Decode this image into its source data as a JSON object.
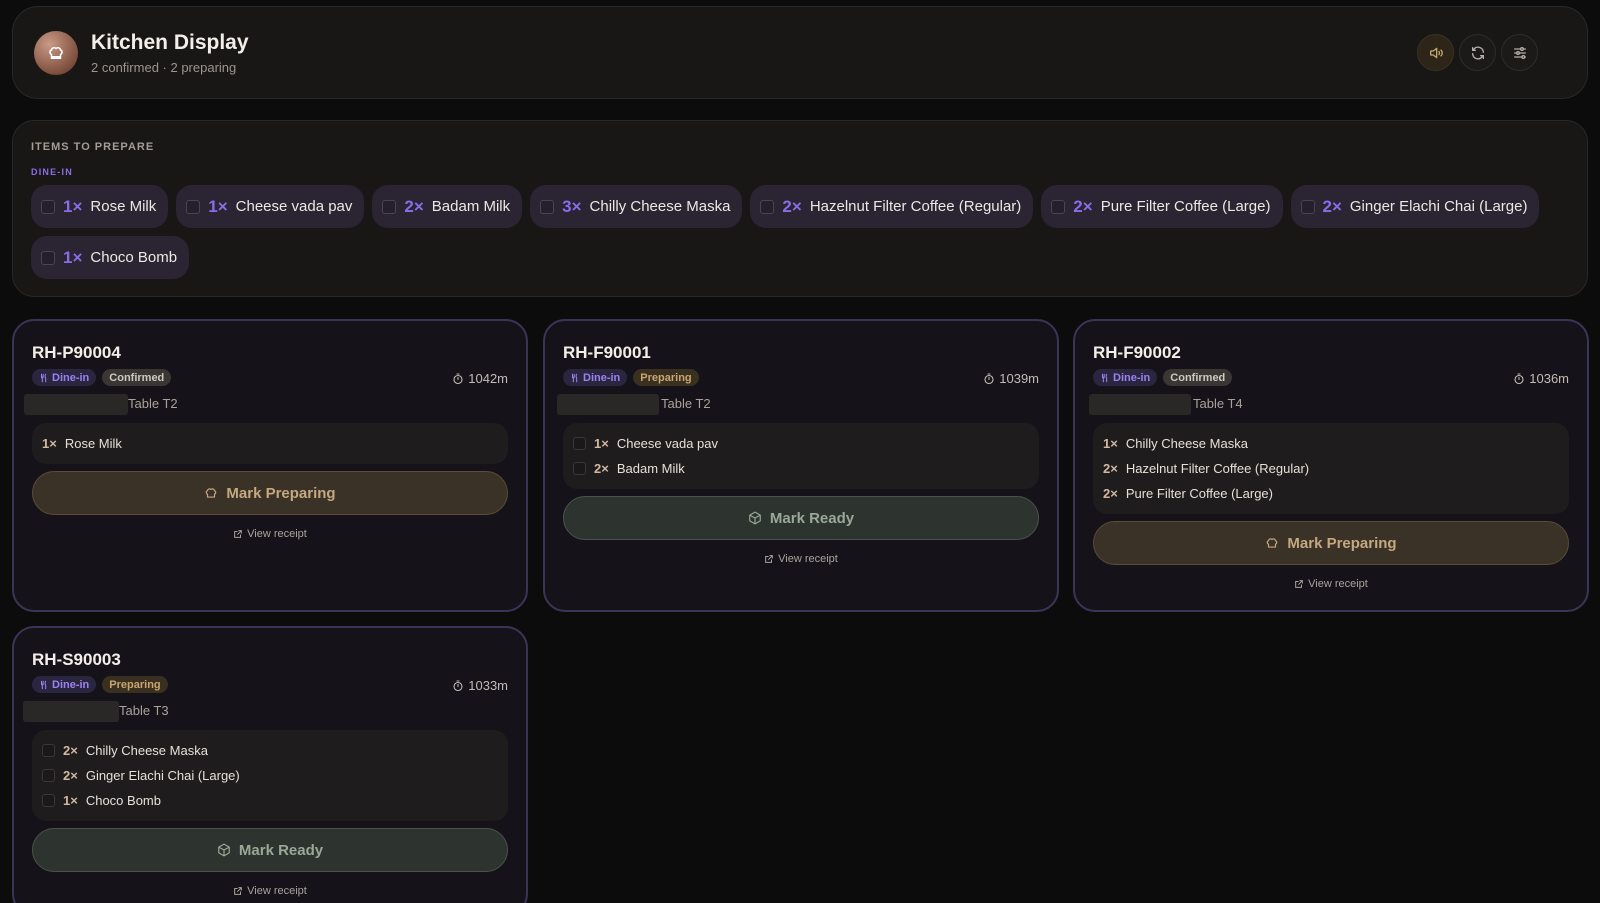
{
  "header": {
    "title": "Kitchen Display",
    "subtitle": "2 confirmed · 2 preparing",
    "buttons": [
      "sound-icon",
      "refresh-icon",
      "settings-sliders-icon"
    ]
  },
  "items_panel": {
    "title": "ITEMS TO PREPARE",
    "group": "DINE-IN",
    "items": [
      {
        "qty": "1×",
        "name": "Rose Milk"
      },
      {
        "qty": "1×",
        "name": "Cheese vada pav"
      },
      {
        "qty": "2×",
        "name": "Badam Milk"
      },
      {
        "qty": "3×",
        "name": "Chilly Cheese Maska"
      },
      {
        "qty": "2×",
        "name": "Hazelnut Filter Coffee (Regular)"
      },
      {
        "qty": "2×",
        "name": "Pure Filter Coffee (Large)"
      },
      {
        "qty": "2×",
        "name": "Ginger Elachi Chai (Large)"
      },
      {
        "qty": "1×",
        "name": "Choco Bomb"
      }
    ]
  },
  "orders": [
    {
      "id": "RH-P90004",
      "type": "Dine-in",
      "status": "Confirmed",
      "timer": "1042m",
      "table": "Table T2",
      "items": [
        {
          "qty": "1×",
          "name": "Rose Milk"
        }
      ],
      "action": "Mark Preparing",
      "receipt": "View receipt"
    },
    {
      "id": "RH-F90001",
      "type": "Dine-in",
      "status": "Preparing",
      "timer": "1039m",
      "table": "Table T2",
      "items": [
        {
          "qty": "1×",
          "name": "Cheese vada pav"
        },
        {
          "qty": "2×",
          "name": "Badam Milk"
        }
      ],
      "action": "Mark Ready",
      "receipt": "View receipt"
    },
    {
      "id": "RH-F90002",
      "type": "Dine-in",
      "status": "Confirmed",
      "timer": "1036m",
      "table": "Table T4",
      "items": [
        {
          "qty": "1×",
          "name": "Chilly Cheese Maska"
        },
        {
          "qty": "2×",
          "name": "Hazelnut Filter Coffee (Regular)"
        },
        {
          "qty": "2×",
          "name": "Pure Filter Coffee (Large)"
        }
      ],
      "action": "Mark Preparing",
      "receipt": "View receipt"
    },
    {
      "id": "RH-S90003",
      "type": "Dine-in",
      "status": "Preparing",
      "timer": "1033m",
      "table": "Table T3",
      "items": [
        {
          "qty": "2×",
          "name": "Chilly Cheese Maska"
        },
        {
          "qty": "2×",
          "name": "Ginger Elachi Chai (Large)"
        },
        {
          "qty": "1×",
          "name": "Choco Bomb"
        }
      ],
      "action": "Mark Ready",
      "receipt": "View receipt"
    }
  ],
  "colors": {
    "background": "#0d0c0c",
    "accent_purple": "#8b6ce8",
    "preparing_amber": "#c9a670",
    "ready_green": "#9aa897"
  }
}
